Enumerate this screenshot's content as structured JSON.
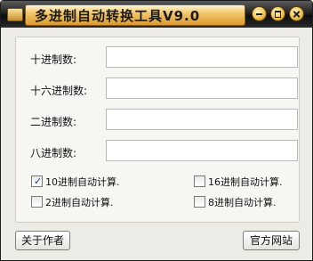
{
  "window": {
    "title": "多进制自动转换工具V9.0"
  },
  "fields": [
    {
      "label": "十进制数:",
      "value": ""
    },
    {
      "label": "十六进制数:",
      "value": ""
    },
    {
      "label": "二进制数:",
      "value": ""
    },
    {
      "label": "八进制数:",
      "value": ""
    }
  ],
  "options": [
    {
      "label": "10进制自动计算.",
      "checked": true
    },
    {
      "label": "16进制自动计算.",
      "checked": false
    },
    {
      "label": "2进制自动计算.",
      "checked": false
    },
    {
      "label": "8进制自动计算.",
      "checked": false
    }
  ],
  "buttons": {
    "about": "关于作者",
    "website": "官方网站"
  },
  "icons": {
    "minimize": "minimize-icon",
    "maximize": "maximize-icon",
    "close": "close-icon",
    "check": "checkmark-icon"
  },
  "colors": {
    "titlebar": "#111111",
    "title_plate": "#f0b84a",
    "window_bg": "#ecebe6"
  }
}
